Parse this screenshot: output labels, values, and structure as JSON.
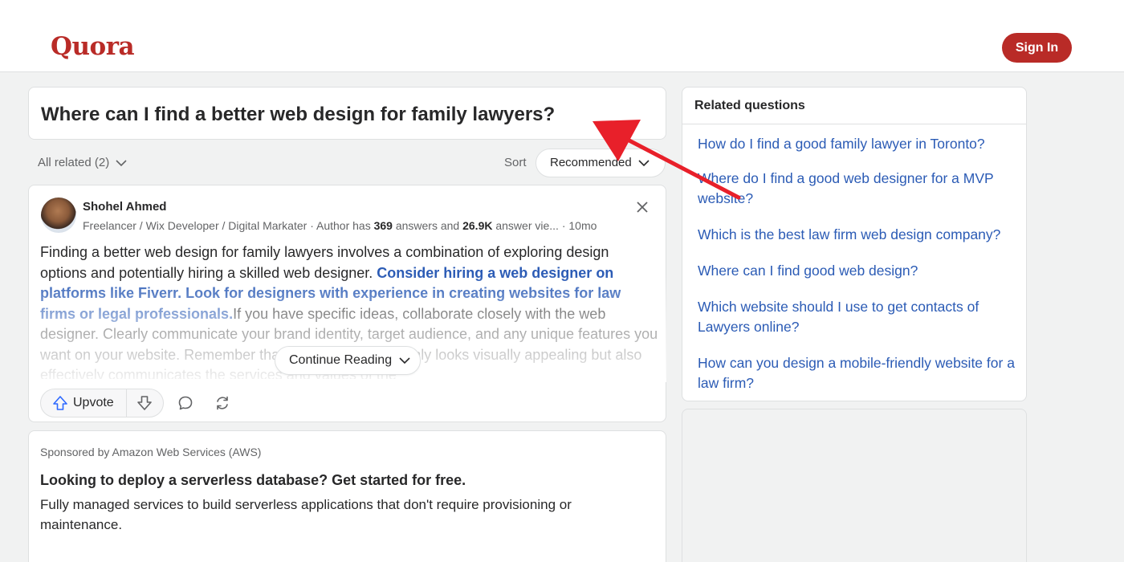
{
  "header": {
    "logo": "Quora",
    "sign_in_label": "Sign In"
  },
  "question": {
    "title": "Where can I find a better web design for family lawyers?"
  },
  "filters": {
    "all_related_label": "All related (2)",
    "sort_label": "Sort",
    "sort_value": "Recommended"
  },
  "answer": {
    "author_name": "Shohel Ahmed",
    "credential_prefix": "Freelancer / Wix Developer / Digital Markater · Author has ",
    "answers_count": "369",
    "credential_mid": " answers and ",
    "views_count": "26.9K",
    "credential_suffix": " answer vie... · 10mo",
    "text_part1": "Finding a better web design for family lawyers involves a combination of exploring design options and potentially hiring a skilled web designer. ",
    "text_highlight": "Consider hiring a web designer on platforms like Fiverr. Look for designers with experience in creating websites for law firms or legal professionals.",
    "text_part2": "If you have specific ideas, collaborate closely with the web designer. Clearly communicate your brand identity, target audience, and any unique features you want on your website. Remember that a website that not only looks visually appealing but also effectively communicates the services and values of the",
    "continue_label": "Continue Reading",
    "upvote_label": "Upvote"
  },
  "ad": {
    "sponsor": "Sponsored by Amazon Web Services (AWS)",
    "title": "Looking to deploy a serverless database? Get started for free.",
    "body": "Fully managed services to build serverless applications that don't require provisioning or maintenance."
  },
  "related": {
    "heading": "Related questions",
    "items": [
      "How do I find a good family lawyer in Toronto?",
      "Where do I find a good web designer for a MVP website?",
      "Which is the best law firm web design company?",
      "Where can I find good web design?",
      "Which website should I use to get contacts of Lawyers online?",
      "How can you design a mobile-friendly website for a law firm?"
    ]
  },
  "colors": {
    "brand": "#b92b27",
    "link": "#2b5bb5",
    "annotation_arrow": "#e8202a"
  }
}
